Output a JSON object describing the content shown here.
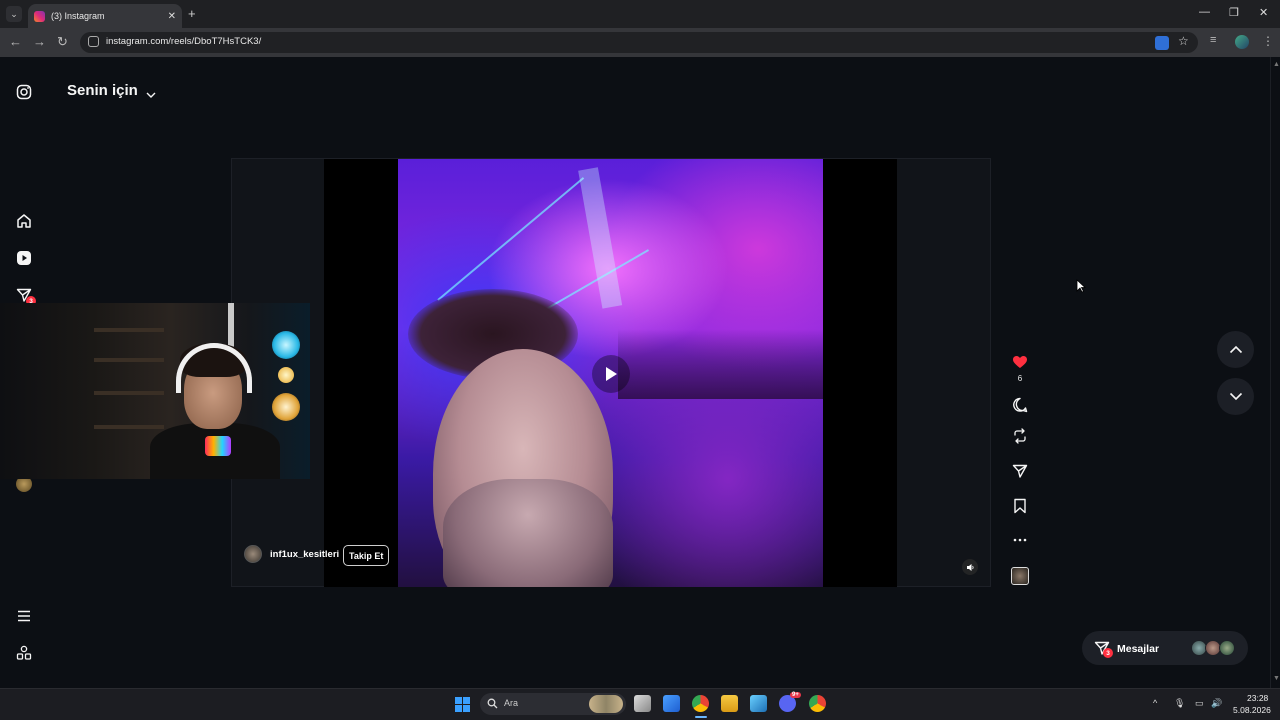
{
  "browser": {
    "tab_title": "(3) Instagram",
    "new_tab": "+",
    "url": "instagram.com/reels/DboT7HsTCK3/",
    "window_controls": [
      "minimize-icon",
      "restore-icon",
      "close-icon"
    ]
  },
  "sidebar": {
    "items": [
      {
        "name": "instagram-logo-icon"
      },
      {
        "name": "home-icon"
      },
      {
        "name": "reels-icon"
      },
      {
        "name": "direct-messages-icon",
        "badge": "3"
      },
      {
        "name": "menu-icon"
      },
      {
        "name": "more-apps-icon"
      }
    ]
  },
  "header": {
    "title": "Senin için",
    "chevron": "chevron-down-icon"
  },
  "reel": {
    "author": "inf1ux_kesitleri",
    "follow_label": "Takip Et",
    "like_count": "6",
    "actions": [
      "heart-icon",
      "comment-icon",
      "repost-icon",
      "share-icon",
      "bookmark-icon",
      "more-icon"
    ]
  },
  "messages": {
    "label": "Mesajlar",
    "badge": "3"
  },
  "taskbar": {
    "search_label": "Ara",
    "time": "23:28",
    "date": "5.08.2026",
    "discord_badge": "9+"
  },
  "colors": {
    "like": "#ff3040",
    "background": "#0c0f14",
    "accent_blue": "#3aa0ff"
  }
}
